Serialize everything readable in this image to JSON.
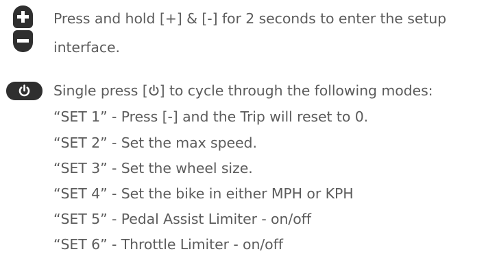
{
  "icons": {
    "plus_button": "plus-icon",
    "minus_button": "minus-icon",
    "power_button": "power-icon",
    "button_color": "#2f2f2f",
    "text_color": "#5c5c5c"
  },
  "setup": {
    "line1": "Press and hold [+] & [-] for 2 seconds to enter the setup",
    "line2": "interface."
  },
  "modes": {
    "intro_prefix": "Single press [",
    "intro_suffix": "] to cycle through the following modes:",
    "items": [
      "“SET 1” - Press [-] and the Trip will reset to 0.",
      "“SET 2” - Set the max speed.",
      "“SET 3” - Set the wheel size.",
      "“SET 4” - Set the bike in either MPH or KPH",
      "“SET 5” - Pedal Assist Limiter - on/off",
      "“SET 6” - Throttle Limiter - on/off"
    ]
  }
}
